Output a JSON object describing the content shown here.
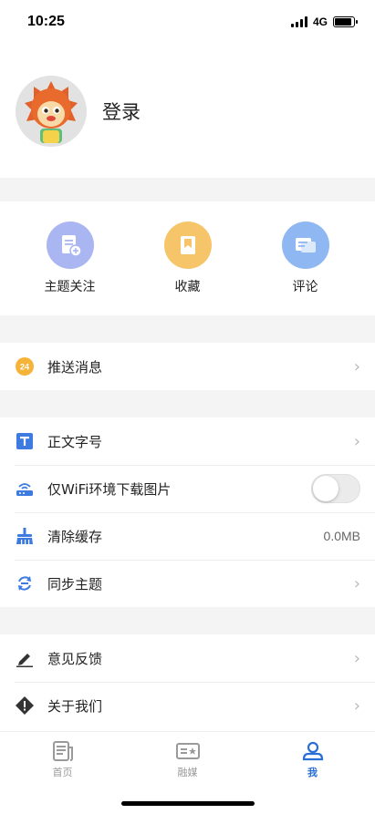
{
  "status_bar": {
    "time": "10:25",
    "network": "4G"
  },
  "profile": {
    "login_label": "登录"
  },
  "quick_actions": [
    {
      "label": "主题关注",
      "icon": "topic-follow-icon",
      "color": "#a9b6f2"
    },
    {
      "label": "收藏",
      "icon": "bookmark-icon",
      "color": "#f6c56a"
    },
    {
      "label": "评论",
      "icon": "comment-icon",
      "color": "#8fb8f2"
    }
  ],
  "push": {
    "label": "推送消息",
    "badge": "24",
    "badge_color": "#f6b33a"
  },
  "settings": {
    "font_size": {
      "label": "正文字号",
      "icon_color": "#3d7be0"
    },
    "wifi_images": {
      "label": "仅WiFi环境下载图片",
      "enabled": false,
      "icon_color": "#3d7be0"
    },
    "clear_cache": {
      "label": "清除缓存",
      "value": "0.0MB",
      "icon_color": "#3d7be0"
    },
    "sync_topics": {
      "label": "同步主题",
      "icon_color": "#3d7be0"
    }
  },
  "about": {
    "feedback": {
      "label": "意见反馈"
    },
    "about_us": {
      "label": "关于我们"
    }
  },
  "tabbar": {
    "tabs": [
      {
        "label": "首页",
        "active": false
      },
      {
        "label": "融媒",
        "active": false
      },
      {
        "label": "我",
        "active": true
      }
    ],
    "active_color": "#2b6fd6"
  }
}
